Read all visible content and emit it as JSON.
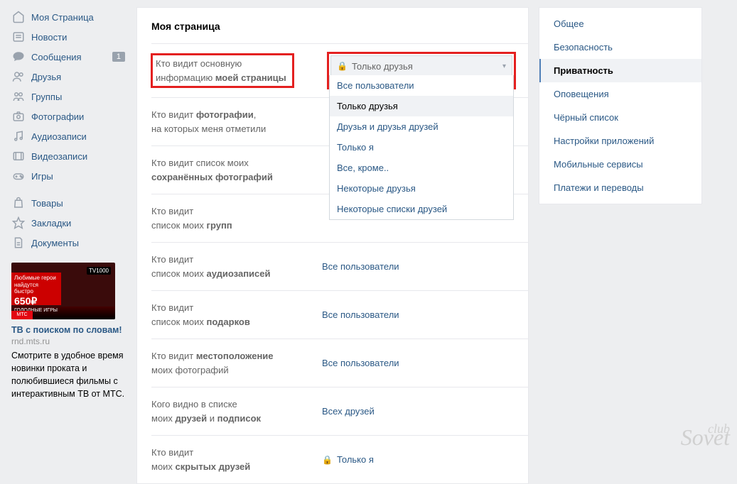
{
  "sidebar": {
    "items": [
      {
        "icon": "home",
        "label": "Моя Страница"
      },
      {
        "icon": "news",
        "label": "Новости"
      },
      {
        "icon": "msg",
        "label": "Сообщения",
        "badge": "1"
      },
      {
        "icon": "friends",
        "label": "Друзья"
      },
      {
        "icon": "groups",
        "label": "Группы"
      },
      {
        "icon": "photos",
        "label": "Фотографии"
      },
      {
        "icon": "audio",
        "label": "Аудиозаписи"
      },
      {
        "icon": "video",
        "label": "Видеозаписи"
      },
      {
        "icon": "games",
        "label": "Игры"
      }
    ],
    "items2": [
      {
        "icon": "market",
        "label": "Товары"
      },
      {
        "icon": "fav",
        "label": "Закладки"
      },
      {
        "icon": "docs",
        "label": "Документы"
      }
    ]
  },
  "ad": {
    "badge": "TV1000",
    "strip1": "Любимые герои",
    "strip2": "найдутся быстро",
    "price": "650₽",
    "mts": "МТС",
    "bottom": "ГОЛОДНЫЕ ИГРЫ",
    "title": "ТВ с поиском по словам!",
    "domain": "rnd.mts.ru",
    "desc": "Смотрите в удобное время новинки проката и полюбившиеся фильмы с интерактивным ТВ от МТС."
  },
  "main": {
    "title": "Моя страница",
    "rows": [
      {
        "l1": "Кто видит основную",
        "l2_pre": "информацию ",
        "l2_bold": "моей страницы"
      },
      {
        "l1_pre": "Кто видит ",
        "l1_bold": "фотографии",
        "l1_post": ",",
        "l2": "на которых меня отметили"
      },
      {
        "l1": "Кто видит список моих",
        "l2_bold": "сохранённых фотографий"
      },
      {
        "l1": "Кто видит",
        "l2_pre": "список моих ",
        "l2_bold": "групп"
      },
      {
        "l1": "Кто видит",
        "l2_pre": "список моих ",
        "l2_bold": "аудиозаписей",
        "value": "Все пользователи"
      },
      {
        "l1": "Кто видит",
        "l2_pre": "список моих ",
        "l2_bold": "подарков",
        "value": "Все пользователи"
      },
      {
        "l1_pre": "Кто видит ",
        "l1_bold": "местоположение",
        "l2": "моих фотографий",
        "value": "Все пользователи"
      },
      {
        "l1": "Кого видно в списке",
        "l2_pre": "моих ",
        "l2_bold": "друзей",
        "l2_mid": " и ",
        "l2_bold2": "подписок",
        "value": "Всех друзей"
      },
      {
        "l1": "Кто видит",
        "l2_pre": "моих ",
        "l2_bold": "скрытых друзей",
        "value": "Только я",
        "lock": true
      }
    ],
    "dropdown": {
      "selected": "Только друзья",
      "options": [
        "Все пользователи",
        "Только друзья",
        "Друзья и друзья друзей",
        "Только я",
        "Все, кроме..",
        "Некоторые друзья",
        "Некоторые списки друзей"
      ]
    }
  },
  "right": {
    "items": [
      "Общее",
      "Безопасность",
      "Приватность",
      "Оповещения",
      "Чёрный список",
      "Настройки приложений",
      "Мобильные сервисы",
      "Платежи и переводы"
    ],
    "active": 2
  },
  "watermark": {
    "small": "club",
    "big": "Sovet"
  }
}
